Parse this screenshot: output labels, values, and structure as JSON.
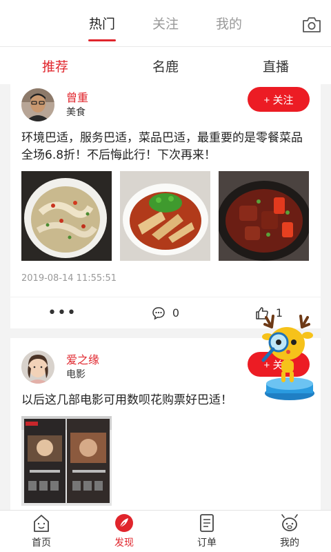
{
  "top_tabs": [
    "热门",
    "关注",
    "我的"
  ],
  "sub_tabs": [
    "推荐",
    "名鹿",
    "直播"
  ],
  "posts": [
    {
      "user": "曾重",
      "category": "美食",
      "follow_label": "+ 关注",
      "text": "环境巴适，服务巴适，菜品巴适，最重要的是零餐菜品全场6.8折！不后悔此行！下次再来！",
      "time": "2019-08-14 11:55:51",
      "comments": "0",
      "likes": "1"
    },
    {
      "user": "爱之缘",
      "category": "电影",
      "follow_label": "+ 关注",
      "text": "以后这几部电影可用数呗花购票好巴适！"
    }
  ],
  "tabbar": [
    {
      "label": "首页",
      "icon": "home-icon"
    },
    {
      "label": "发现",
      "icon": "discover-icon"
    },
    {
      "label": "订单",
      "icon": "order-icon"
    },
    {
      "label": "我的",
      "icon": "profile-icon"
    }
  ],
  "colors": {
    "accent": "#e0252c",
    "follow_bg": "#ec1c24"
  }
}
